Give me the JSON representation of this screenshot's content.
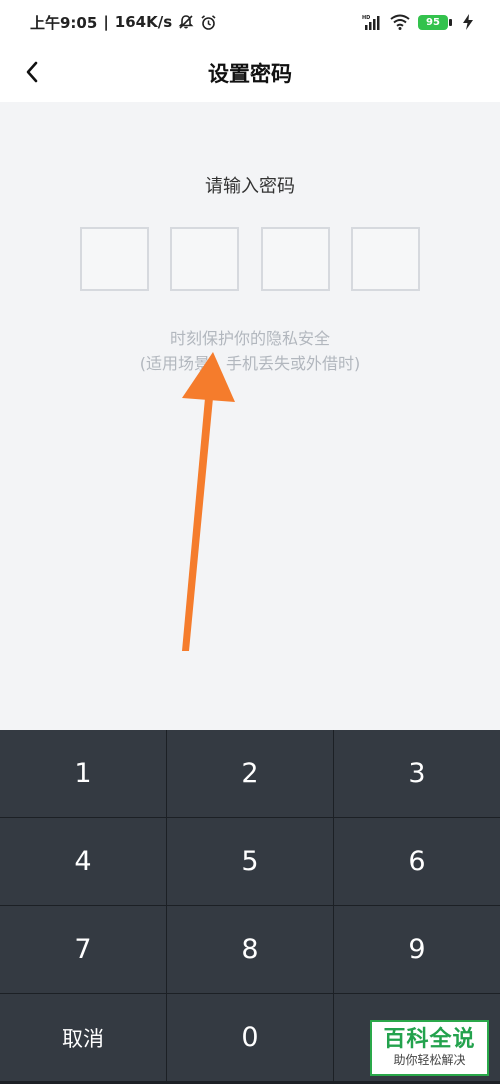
{
  "status_bar": {
    "time": "上午9:05",
    "separator": "|",
    "speed": "164K/s",
    "battery": "95",
    "icons": [
      "mute-bell-icon",
      "alarm-icon",
      "signal-icon",
      "wifi-icon",
      "battery-icon",
      "charging-icon"
    ]
  },
  "header": {
    "title": "设置密码",
    "back_icon": "chevron-left-icon"
  },
  "main": {
    "prompt": "请输入密码",
    "pin_length": 4,
    "hint_line1": "时刻保护你的隐私安全",
    "hint_line2": "(适用场景：手机丢失或外借时)"
  },
  "keypad": {
    "keys": [
      "1",
      "2",
      "3",
      "4",
      "5",
      "6",
      "7",
      "8",
      "9",
      "取消",
      "0",
      ""
    ]
  },
  "watermark": {
    "title": "百科全说",
    "subtitle": "助你轻松解决"
  },
  "colors": {
    "background": "#f3f4f6",
    "keypad": "#343a42",
    "arrow": "#f57c2c",
    "battery": "#33c24d",
    "watermark": "#23a24d"
  }
}
